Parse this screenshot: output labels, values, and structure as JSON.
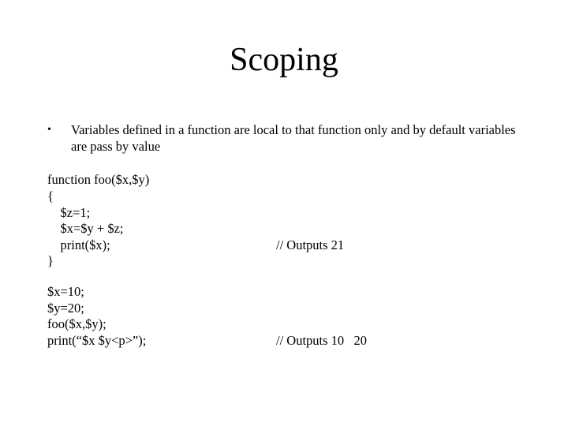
{
  "title": "Scoping",
  "bullet": {
    "marker": "•",
    "text": "Variables defined in a function are local to that function only and by default variables are pass by value"
  },
  "code1": {
    "l1": "function foo($x,$y)",
    "l2": "{",
    "l3": "    $z=1;",
    "l4": "    $x=$y + $z;",
    "l5": "    print($x);",
    "l5c": "// Outputs 21",
    "l6": "}"
  },
  "code2": {
    "l1": "$x=10;",
    "l2": "$y=20;",
    "l3": "foo($x,$y);",
    "l4": "print(“$x $y<p>”);",
    "l4c": "// Outputs 10   20"
  }
}
